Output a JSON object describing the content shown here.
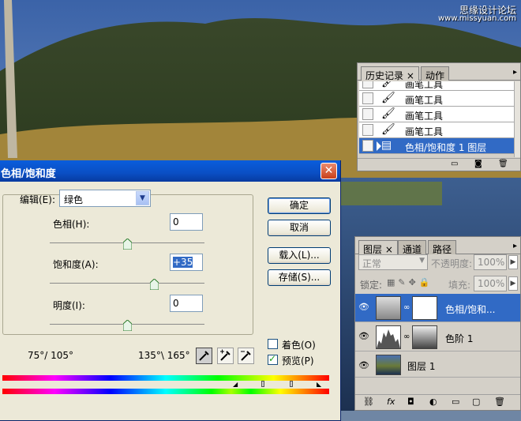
{
  "watermark": {
    "line1": "思缘设计论坛",
    "line2": "www.missyuan.com"
  },
  "dialog": {
    "title": "色相/饱和度",
    "close_glyph": "✕",
    "edit_label": "编辑(E):",
    "edit_value": "绿色",
    "hue_label": "色相(H):",
    "hue_value": "0",
    "saturation_label": "饱和度(A):",
    "saturation_value": "+35",
    "lightness_label": "明度(I):",
    "lightness_value": "0",
    "slider_positions": {
      "hue": 0.5,
      "saturation": 0.675,
      "lightness": 0.5
    },
    "buttons": {
      "ok": "确定",
      "cancel": "取消",
      "load": "载入(L)...",
      "save": "存储(S)..."
    },
    "colorize_label": "着色(O)",
    "colorize_checked": false,
    "preview_label": "预览(P)",
    "preview_checked": true,
    "range_left": "75°/ 105°",
    "range_right": "135°\\ 165°",
    "eyedropper_icons": [
      "eyedropper-icon",
      "eyedropper-plus-icon",
      "eyedropper-minus-icon"
    ]
  },
  "history": {
    "tabs": [
      "历史记录",
      "动作"
    ],
    "tab_close": "×",
    "items": [
      {
        "label": "画笔工具",
        "icon": "brush-icon"
      },
      {
        "label": "画笔工具",
        "icon": "brush-icon"
      },
      {
        "label": "画笔工具",
        "icon": "brush-icon"
      },
      {
        "label": "画笔工具",
        "icon": "brush-icon"
      },
      {
        "label": "色相/饱和度 1 图层",
        "icon": "adjustment-layer-icon",
        "active": true
      }
    ]
  },
  "layers": {
    "tabs": [
      "图层",
      "通道",
      "路径"
    ],
    "tab_close": "×",
    "blend_mode": "正常",
    "opacity_label": "不透明度:",
    "opacity_value": "100%",
    "lock_label": "锁定:",
    "fill_label": "填充:",
    "fill_value": "100%",
    "items": [
      {
        "name": "色相/饱和...",
        "type": "adjustment",
        "active": true
      },
      {
        "name": "色阶 1",
        "type": "levels",
        "active": false
      },
      {
        "name": "图层 1",
        "type": "image",
        "active": false
      }
    ]
  },
  "colors": {
    "title_bar": "#0a4fc4",
    "selection": "#316ac5",
    "dialog_bg": "#ece9d8"
  }
}
